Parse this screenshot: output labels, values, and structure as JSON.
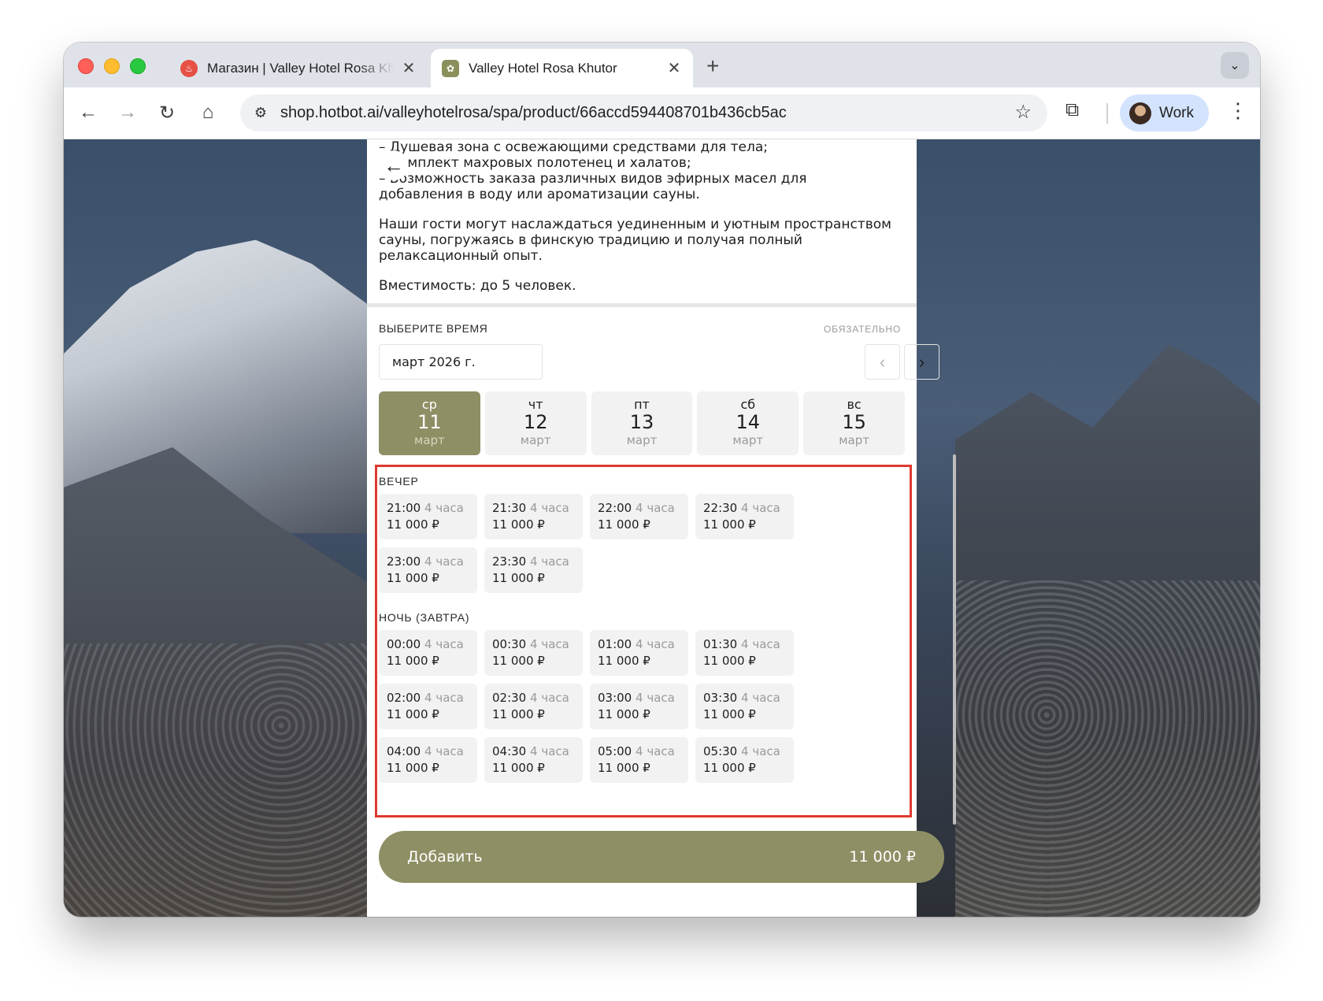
{
  "browser": {
    "tabs": [
      {
        "title": "Магазин | Valley Hotel Rosa Khutor",
        "close": "✕"
      },
      {
        "title": "Valley Hotel Rosa Khutor",
        "close": "✕"
      }
    ],
    "new_tab": "+",
    "url": "shop.hotbot.ai/valleyhotelrosa/spa/product/66accd594408701b436cb5ac",
    "profile_name": "Work"
  },
  "description": {
    "lines": [
      "– Душевая зона с освежающими средствами для тела;",
      "– Комплект махровых полотенец и халатов;",
      "– Возможность заказа различных видов эфирных масел для",
      "добавления в воду или ароматизации сауны."
    ],
    "paragraph": "Наши гости могут наслаждаться уединенным и уютным пространством сауны, погружаясь в финскую традицию и получая полный релаксационный опыт.",
    "capacity": "Вместимость: до 5 человек."
  },
  "time_picker": {
    "title": "ВЫБЕРИТЕ ВРЕМЯ",
    "required": "ОБЯЗАТЕЛЬНО",
    "month": "март 2026 г.",
    "days": [
      {
        "weekday": "ср",
        "day": "11",
        "month": "март",
        "selected": true
      },
      {
        "weekday": "чт",
        "day": "12",
        "month": "март",
        "selected": false
      },
      {
        "weekday": "пт",
        "day": "13",
        "month": "март",
        "selected": false
      },
      {
        "weekday": "сб",
        "day": "14",
        "month": "март",
        "selected": false
      },
      {
        "weekday": "вс",
        "day": "15",
        "month": "март",
        "selected": false
      }
    ],
    "groups": [
      {
        "title": "ВЕЧЕР",
        "slots": [
          {
            "time": "21:00",
            "duration": "4 часа",
            "price": "11 000 ₽"
          },
          {
            "time": "21:30",
            "duration": "4 часа",
            "price": "11 000 ₽"
          },
          {
            "time": "22:00",
            "duration": "4 часа",
            "price": "11 000 ₽"
          },
          {
            "time": "22:30",
            "duration": "4 часа",
            "price": "11 000 ₽"
          },
          {
            "time": "23:00",
            "duration": "4 часа",
            "price": "11 000 ₽"
          },
          {
            "time": "23:30",
            "duration": "4 часа",
            "price": "11 000 ₽"
          }
        ]
      },
      {
        "title": "НОЧЬ (ЗАВТРА)",
        "slots": [
          {
            "time": "00:00",
            "duration": "4 часа",
            "price": "11 000 ₽"
          },
          {
            "time": "00:30",
            "duration": "4 часа",
            "price": "11 000 ₽"
          },
          {
            "time": "01:00",
            "duration": "4 часа",
            "price": "11 000 ₽"
          },
          {
            "time": "01:30",
            "duration": "4 часа",
            "price": "11 000 ₽"
          },
          {
            "time": "02:00",
            "duration": "4 часа",
            "price": "11 000 ₽"
          },
          {
            "time": "02:30",
            "duration": "4 часа",
            "price": "11 000 ₽"
          },
          {
            "time": "03:00",
            "duration": "4 часа",
            "price": "11 000 ₽"
          },
          {
            "time": "03:30",
            "duration": "4 часа",
            "price": "11 000 ₽"
          },
          {
            "time": "04:00",
            "duration": "4 часа",
            "price": "11 000 ₽"
          },
          {
            "time": "04:30",
            "duration": "4 часа",
            "price": "11 000 ₽"
          },
          {
            "time": "05:00",
            "duration": "4 часа",
            "price": "11 000 ₽"
          },
          {
            "time": "05:30",
            "duration": "4 часа",
            "price": "11 000 ₽"
          }
        ]
      }
    ]
  },
  "add_button": {
    "label": "Добавить",
    "price": "11 000 ₽"
  },
  "colors": {
    "accent": "#8e8f64",
    "highlight": "#e0392f"
  }
}
